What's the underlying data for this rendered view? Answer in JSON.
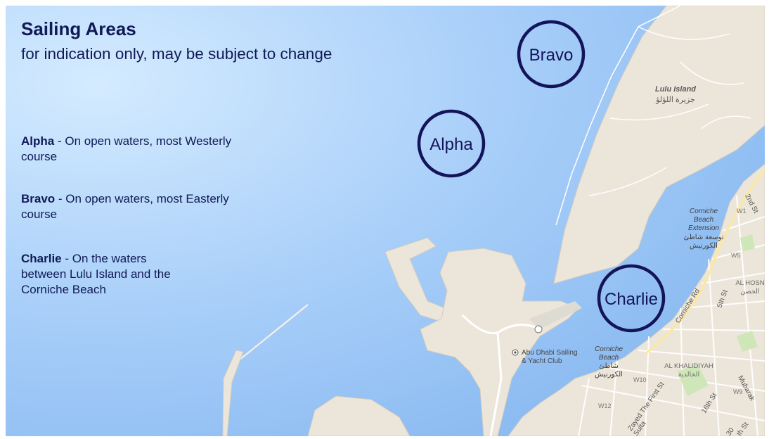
{
  "heading": {
    "title": "Sailing Areas",
    "subtitle": "for indication only, may be subject to change"
  },
  "legend": [
    {
      "name": "Alpha",
      "sep": " - ",
      "description": "On open waters, most Westerly course"
    },
    {
      "name": "Bravo",
      "sep": " -  ",
      "description": "On open waters, most Easterly course"
    },
    {
      "name": "Charlie",
      "sep": " - ",
      "description": "On the waters between Lulu Island and the Corniche Beach"
    }
  ],
  "course_markers": [
    {
      "label": "Bravo"
    },
    {
      "label": "Alpha"
    },
    {
      "label": "Charlie"
    }
  ],
  "map_labels": {
    "lulu_island_en": "Lulu Island",
    "lulu_island_ar": "جزيرة اللؤلؤ",
    "corniche_ext_line1": "Corniche",
    "corniche_ext_line2": "Beach",
    "corniche_ext_line3": "Extension",
    "corniche_ext_ar1": "توسعة شاطئ",
    "corniche_ext_ar2": "الكورنيش",
    "corniche_beach_line1": "Corniche",
    "corniche_beach_line2": "Beach",
    "corniche_beach_ar1": "شاطئ",
    "corniche_beach_ar2": "الكورنيش",
    "yacht_club_line1": "Abu Dhabi Sailing",
    "yacht_club_line2": "& Yacht Club",
    "al_hosn_en": "AL HOSN",
    "al_hosn_ar": "الحصن",
    "al_khalidiyah_en": "AL KHALIDIYAH",
    "al_khalidiyah_ar": "الخالدية",
    "road_corniche": "Corniche Rd",
    "road_2nd": "2nd St",
    "road_5th": "5th St",
    "road_16th": "16th St",
    "road_zayed": "Zayed The First St",
    "road_mubarak": "Mubarak",
    "road_sultan": "Sulta",
    "road_30th": "30",
    "road_th": "th St",
    "zone_w1": "W1",
    "zone_w5": "W5",
    "zone_w9": "W9",
    "zone_w10": "W10",
    "zone_w12": "W12"
  },
  "colors": {
    "sea_light": "#cfe7ff",
    "sea": "#9ec8f7",
    "land": "#ece6da",
    "road": "#ffffff",
    "park": "#cfe7b8",
    "marker_ring": "#14145a",
    "text": "#101a55"
  }
}
